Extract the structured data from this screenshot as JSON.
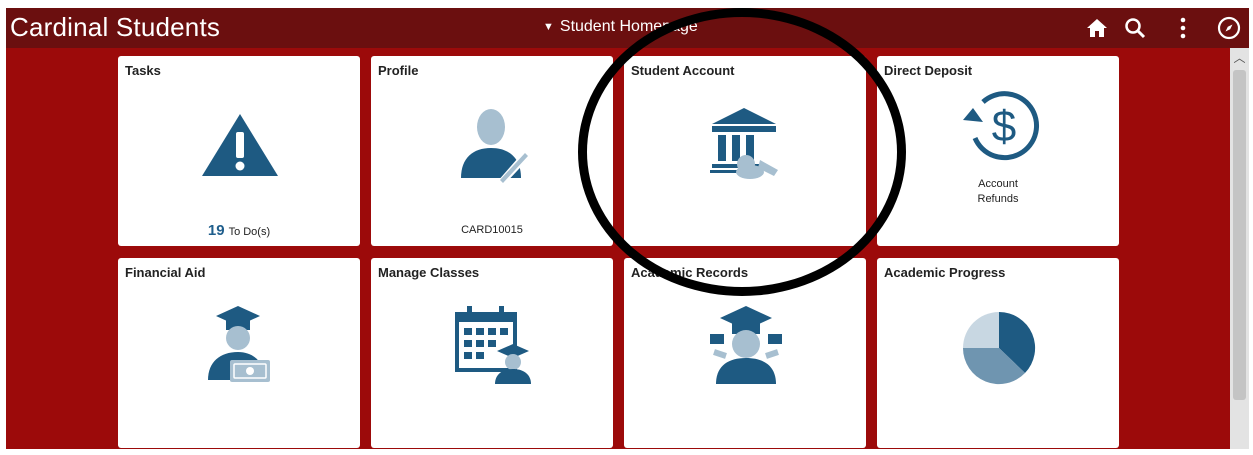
{
  "header": {
    "app_title": "Cardinal Students",
    "page_selector": "Student Homepage",
    "icons": [
      "home-icon",
      "search-icon",
      "actions-menu-icon",
      "navbar-compass-icon"
    ]
  },
  "tiles": [
    {
      "title": "Tasks",
      "count": "19",
      "count_label": "To Do(s)",
      "icon": "warning-icon"
    },
    {
      "title": "Profile",
      "subtitle": "CARD10015",
      "icon": "profile-icon"
    },
    {
      "title": "Student Account",
      "icon": "bank-icon"
    },
    {
      "title": "Direct Deposit",
      "subtitle_line1": "Account",
      "subtitle_line2": "Refunds",
      "icon": "refund-dollar-icon"
    },
    {
      "title": "Financial Aid",
      "icon": "graduate-money-icon"
    },
    {
      "title": "Manage Classes",
      "icon": "calendar-graduate-icon"
    },
    {
      "title": "Academic Records",
      "icon": "graduate-icon"
    },
    {
      "title": "Academic Progress",
      "icon": "pie-chart-icon"
    }
  ],
  "colors": {
    "header": "#6b0f0f",
    "background": "#9c0a0a",
    "icon": "#1e5a82",
    "icon_light": "#a7bfd0"
  }
}
